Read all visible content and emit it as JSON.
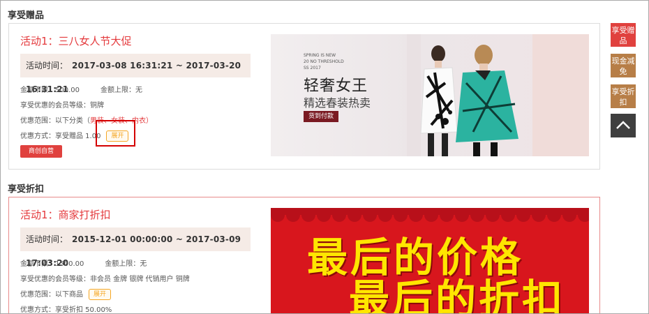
{
  "sections": {
    "gifts_title": "享受赠品",
    "discount_title": "享受折扣"
  },
  "promo1": {
    "name": "活动1：三八女人节大促",
    "time_label": "活动时间：",
    "time_value": "2017-03-08 16:31:21 ~ 2017-03-20 16:31:21",
    "min_amount": "金额下限：500.00",
    "max_amount": "金额上限：无",
    "member_level": "享受优惠的会员等级：铜牌",
    "scope_prefix": "优惠范围：以下分类（",
    "scope_links": "男装、女装、内衣",
    "scope_suffix": "）",
    "method": "优惠方式：享受赠品 1.00",
    "expand_label": "展开",
    "shop_button": "商创自营",
    "banner": {
      "small_en": [
        "SPRING IS NEW",
        "20 NO THRESHOLD",
        "SS 2017"
      ],
      "headline": "轻奢女王",
      "subline": "精选春装热卖",
      "cta": "货到付款"
    }
  },
  "promo2": {
    "name": "活动1：商家打折扣",
    "time_label": "活动时间：",
    "time_value": "2015-12-01 00:00:00 ~ 2017-03-09 17:03:20",
    "min_amount": "金额下限：1500.00",
    "max_amount": "金额上限：无",
    "member_level": "享受优惠的会员等级：非会员 金牌 银牌 代销用户 铜牌",
    "scope": "优惠范围：以下商品",
    "expand_label": "展开",
    "method": "优惠方式：享受折扣 50.00%",
    "banner": {
      "line1": "最后的价格",
      "line2": "最后的折扣"
    }
  },
  "sidebar": {
    "gift": "享受赠品",
    "cash": "现金减免",
    "discount": "享受折扣",
    "top_icon": "chevron-up-icon"
  },
  "colors": {
    "accent_red": "#e4393c",
    "sidebar_brown": "#b77e47",
    "sidebar_dark": "#3f3f3f",
    "timebox_bg": "#f5ebe6",
    "expand_orange": "#f5a623"
  }
}
